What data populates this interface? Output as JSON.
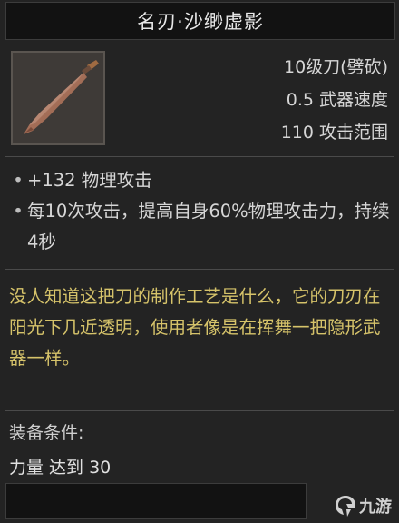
{
  "item": {
    "name": "名刃·沙缈虚影",
    "stats": [
      "10级刀(劈砍)",
      "0.5 武器速度",
      "110 攻击范围"
    ],
    "effects": [
      "+132 物理攻击",
      "每10次攻击，提高自身60%物理攻击力，持续4秒"
    ],
    "flavor": "没人知道这把刀的制作工艺是什么，它的刀刃在阳光下几近透明，使用者像是在挥舞一把隐形武器一样。",
    "requirement_label": "装备条件:",
    "requirement_value": "力量 达到 30",
    "icon": "machete-icon"
  },
  "watermark": {
    "text": "九游",
    "icon": "jiuyou-logo-icon"
  }
}
